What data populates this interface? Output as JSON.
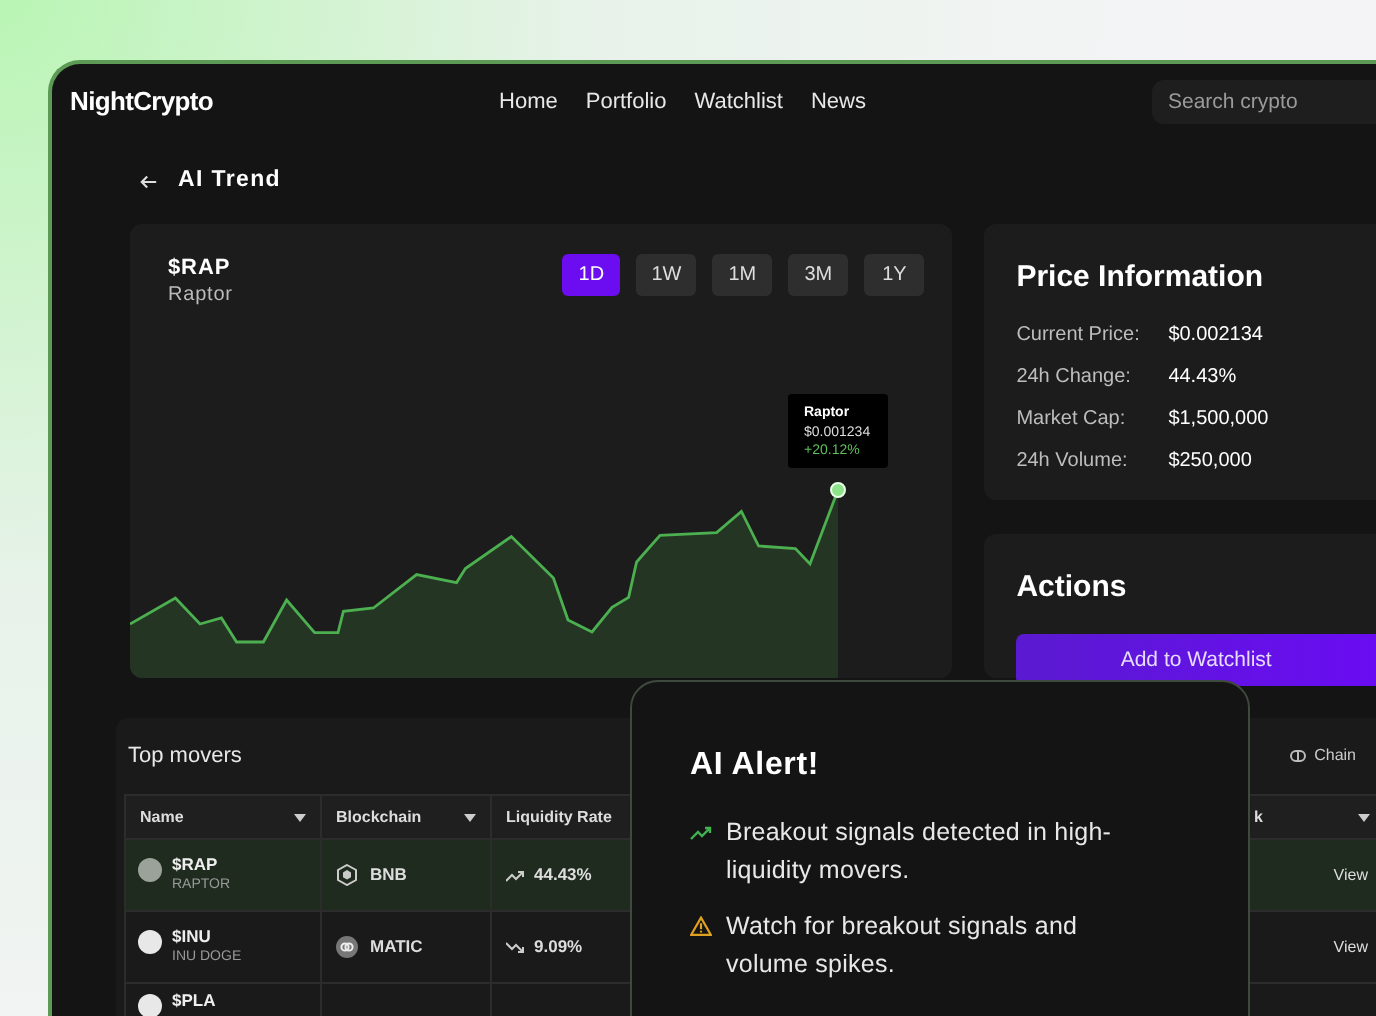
{
  "brand": "NightCrypto",
  "nav": [
    "Home",
    "Portfolio",
    "Watchlist",
    "News"
  ],
  "search": {
    "placeholder": "Search crypto"
  },
  "page_title": "AI Trend",
  "chart_card": {
    "ticker": "$RAP",
    "name": "Raptor",
    "ranges": [
      {
        "label": "1D",
        "selected": true
      },
      {
        "label": "1W",
        "selected": false
      },
      {
        "label": "1M",
        "selected": false
      },
      {
        "label": "3M",
        "selected": false
      },
      {
        "label": "1Y",
        "selected": false
      }
    ],
    "tooltip": {
      "title": "Raptor",
      "price": "$0.001234",
      "change": "+20.12%"
    }
  },
  "price_info": {
    "title": "Price Information",
    "rows": [
      {
        "label": "Current Price:",
        "value": "$0.002134"
      },
      {
        "label": "24h Change:",
        "value": "44.43%"
      },
      {
        "label": "Market Cap:",
        "value": "$1,500,000"
      },
      {
        "label": "24h Volume:",
        "value": "$250,000"
      }
    ]
  },
  "actions": {
    "title": "Actions",
    "button": "Add to Watchlist"
  },
  "top_movers": {
    "title": "Top movers",
    "filter": "Chain",
    "columns": [
      {
        "label": "Name",
        "sortable": true
      },
      {
        "label": "Blockchain",
        "sortable": true
      },
      {
        "label": "Liquidity Rate"
      },
      {
        "label": "k",
        "sortable": true
      }
    ],
    "rows": [
      {
        "symbol": "$RAP",
        "name": "RAPTOR",
        "chain": "BNB",
        "rate": "44.43%",
        "kind": "up",
        "selected": true,
        "action": "View"
      },
      {
        "symbol": "$INU",
        "name": "INU DOGE",
        "chain": "MATIC",
        "rate": "9.09%",
        "kind": "down",
        "selected": false,
        "action": "View"
      },
      {
        "symbol": "$PLA",
        "selected": false
      }
    ]
  },
  "alert": {
    "title": "AI Alert!",
    "items": [
      {
        "kind": "trend",
        "text": "Breakout signals detected in high-liquidity movers."
      },
      {
        "kind": "warning",
        "text": "Watch for breakout signals and volume spikes."
      }
    ]
  }
}
